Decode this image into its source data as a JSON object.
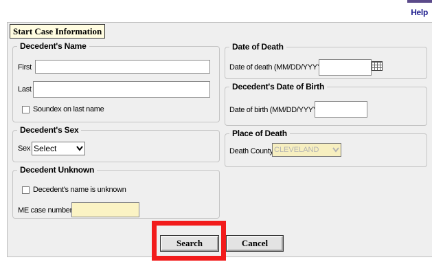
{
  "header": {
    "help_label": "Help"
  },
  "tab": {
    "title": "Start Case Information"
  },
  "decedent_name": {
    "legend": "Decedent's Name",
    "first_label": "First",
    "first_value": "",
    "last_label": "Last",
    "last_value": "",
    "soundex_label": "Soundex on last name"
  },
  "decedent_sex": {
    "legend": "Decedent's Sex",
    "sex_label": "Sex",
    "sex_selected": "Select"
  },
  "decedent_unknown": {
    "legend": "Decedent Unknown",
    "unknown_label": "Decedent's name is unknown",
    "me_label": "ME case number",
    "me_value": ""
  },
  "date_of_death": {
    "legend": "Date of Death",
    "label": "Date of death (MM/DD/YYYY)",
    "value": ""
  },
  "date_of_birth": {
    "legend": "Decedent's Date of Birth",
    "label": "Date of birth (MM/DD/YYYY)",
    "value": ""
  },
  "place_of_death": {
    "legend": "Place of Death",
    "county_label": "Death County",
    "county_selected": "CLEVELAND"
  },
  "actions": {
    "search_label": "Search",
    "cancel_label": "Cancel"
  },
  "colors": {
    "highlight": "#f21b1b",
    "required_field": "#fbf3c4",
    "panel": "#efefef"
  }
}
